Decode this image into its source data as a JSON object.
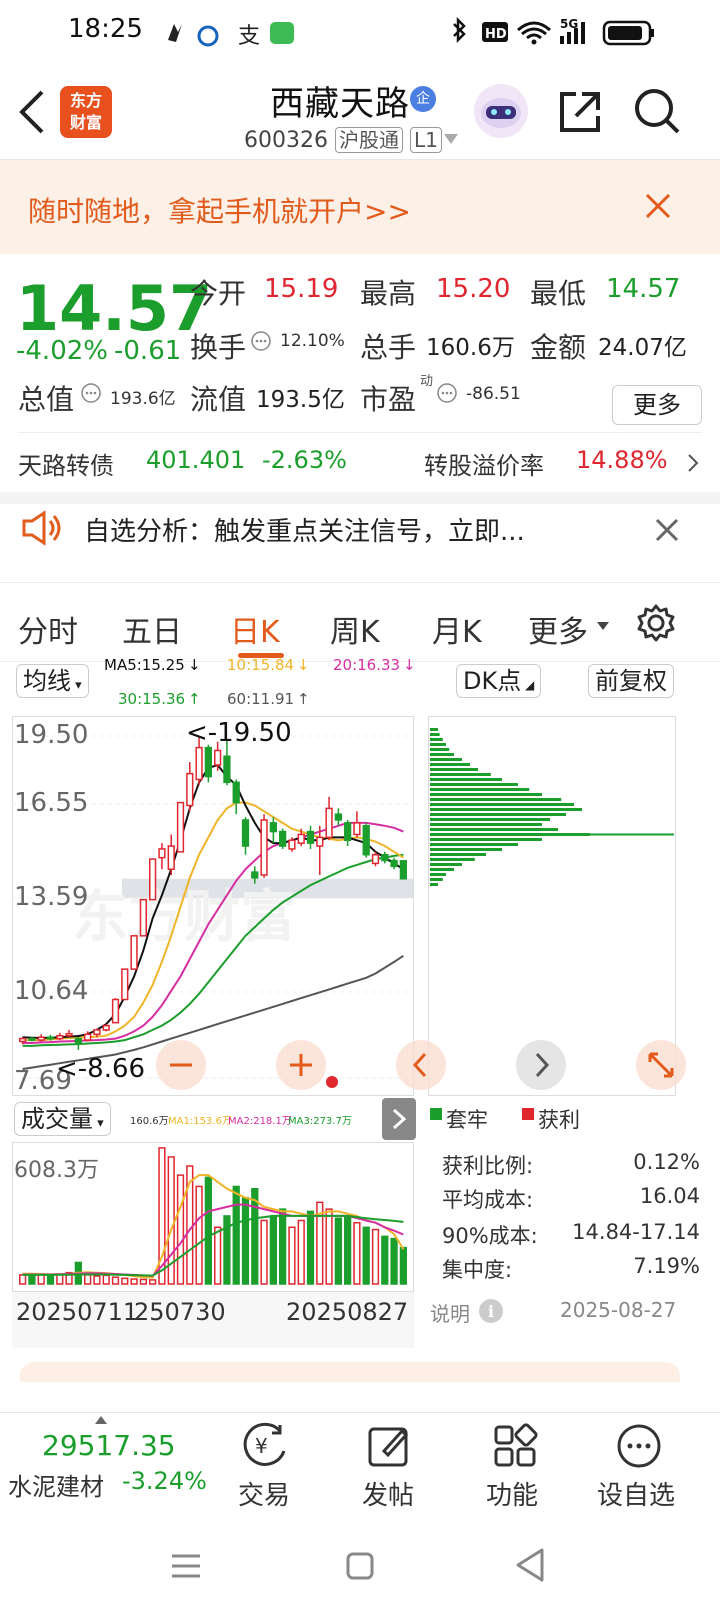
{
  "status": {
    "time": "18:25",
    "network": "5G"
  },
  "header": {
    "title": "西藏天路",
    "badge": "企",
    "code": "600326",
    "tag1": "沪股通",
    "tag2": "L1",
    "logo_line1": "东方",
    "logo_line2": "财富"
  },
  "promo": {
    "text": "随时随地，拿起手机就开户>>"
  },
  "quote": {
    "price": "14.57",
    "change_pct": "-4.02%",
    "change": "-0.61",
    "open_label": "今开",
    "open": "15.19",
    "high_label": "最高",
    "high": "15.20",
    "low_label": "最低",
    "low": "14.57",
    "turnover_label": "换手",
    "turnover": "12.10%",
    "volume_label": "总手",
    "volume": "160.6万",
    "amount_label": "金额",
    "amount": "24.07亿",
    "mktcap_label": "总值",
    "mktcap": "193.6亿",
    "float_label": "流值",
    "float": "193.5亿",
    "pe_label": "市盈",
    "pe_sup": "动",
    "pe": "-86.51",
    "more": "更多"
  },
  "bond": {
    "name": "天路转债",
    "price": "401.401",
    "change": "-2.63%",
    "premium_label": "转股溢价率",
    "premium": "14.88%"
  },
  "alert": {
    "text": "自选分析：触发重点关注信号，立即..."
  },
  "tabs": [
    "分时",
    "五日",
    "日K",
    "周K",
    "月K",
    "更多"
  ],
  "active_tab": "日K",
  "chart": {
    "ma_select": "均线",
    "ma5": "MA5:15.25",
    "ma10": "10:15.84",
    "ma20": "20:16.33",
    "ma30": "30:15.36",
    "ma60": "60:11.91",
    "dk_select": "DK点",
    "adjust_select": "前复权",
    "y_labels": [
      "19.50",
      "16.55",
      "13.59",
      "10.64",
      "7.69"
    ],
    "high_mark": "19.50",
    "low_mark": "8.66",
    "vol_select": "成交量",
    "vol_legend": {
      "v": "160.6万",
      "ma1": "MA1:153.6万",
      "ma2": "MA2:218.1万",
      "ma3": "MA3:273.7万"
    },
    "vol_max": "608.3万",
    "x_labels": [
      "20250711",
      "250730",
      "20250827"
    ],
    "colors": {
      "up": "#e0262f",
      "down": "#1b9e2c",
      "ma5": "#111111",
      "ma10": "#f0b429",
      "ma20": "#d62ea2",
      "ma30": "#1b9e2c",
      "ma60": "#555555"
    }
  },
  "chips": {
    "legend_trap": "套牢",
    "legend_profit": "获利",
    "profit_ratio_label": "获利比例:",
    "profit_ratio": "0.12%",
    "avg_cost_label": "平均成本:",
    "avg_cost": "16.04",
    "cost90_label": "90%成本:",
    "cost90": "14.84-17.14",
    "concentration_label": "集中度:",
    "concentration": "7.19%",
    "note_label": "说明",
    "date": "2025-08-27"
  },
  "bottom": {
    "index_value": "29517.35",
    "index_name": "水泥建材",
    "index_change": "-3.24%",
    "nav": [
      "交易",
      "发帖",
      "功能",
      "设自选"
    ]
  },
  "chart_data": {
    "type": "candlestick",
    "title": "",
    "ylim": [
      7.69,
      19.5
    ],
    "candles": [
      {
        "o": 8.95,
        "c": 9.05,
        "h": 9.1,
        "l": 8.85
      },
      {
        "o": 9.05,
        "c": 9.0,
        "h": 9.12,
        "l": 8.95
      },
      {
        "o": 9.0,
        "c": 9.1,
        "h": 9.2,
        "l": 8.95
      },
      {
        "o": 9.1,
        "c": 9.05,
        "h": 9.18,
        "l": 8.98
      },
      {
        "o": 9.05,
        "c": 9.15,
        "h": 9.25,
        "l": 9.0
      },
      {
        "o": 9.15,
        "c": 9.22,
        "h": 9.35,
        "l": 9.1
      },
      {
        "o": 9.05,
        "c": 8.9,
        "h": 9.1,
        "l": 8.66
      },
      {
        "o": 9.0,
        "c": 9.2,
        "h": 9.3,
        "l": 8.95
      },
      {
        "o": 9.2,
        "c": 9.35,
        "h": 9.4,
        "l": 9.1
      },
      {
        "o": 9.35,
        "c": 9.5,
        "h": 9.55,
        "l": 9.3
      },
      {
        "o": 9.6,
        "c": 10.4,
        "h": 10.45,
        "l": 9.6
      },
      {
        "o": 10.4,
        "c": 11.45,
        "h": 11.45,
        "l": 10.4
      },
      {
        "o": 11.45,
        "c": 12.6,
        "h": 12.6,
        "l": 11.45
      },
      {
        "o": 12.6,
        "c": 13.85,
        "h": 13.85,
        "l": 12.6
      },
      {
        "o": 13.85,
        "c": 15.25,
        "h": 15.25,
        "l": 13.85
      },
      {
        "o": 15.3,
        "c": 15.6,
        "h": 15.8,
        "l": 14.9
      },
      {
        "o": 14.9,
        "c": 15.7,
        "h": 16.1,
        "l": 14.7
      },
      {
        "o": 15.5,
        "c": 17.2,
        "h": 17.2,
        "l": 15.5
      },
      {
        "o": 17.1,
        "c": 18.2,
        "h": 18.6,
        "l": 16.9
      },
      {
        "o": 18.0,
        "c": 19.1,
        "h": 19.5,
        "l": 17.8
      },
      {
        "o": 19.1,
        "c": 18.1,
        "h": 19.2,
        "l": 17.9
      },
      {
        "o": 18.5,
        "c": 19.0,
        "h": 19.3,
        "l": 18.3
      },
      {
        "o": 18.8,
        "c": 17.9,
        "h": 19.4,
        "l": 17.8
      },
      {
        "o": 17.9,
        "c": 17.2,
        "h": 18.0,
        "l": 16.8
      },
      {
        "o": 16.6,
        "c": 15.7,
        "h": 16.7,
        "l": 15.4
      },
      {
        "o": 14.8,
        "c": 14.6,
        "h": 15.0,
        "l": 14.4
      },
      {
        "o": 14.7,
        "c": 16.6,
        "h": 16.8,
        "l": 14.6
      },
      {
        "o": 16.5,
        "c": 16.2,
        "h": 16.7,
        "l": 15.8
      },
      {
        "o": 16.2,
        "c": 15.7,
        "h": 16.3,
        "l": 15.6
      },
      {
        "o": 15.6,
        "c": 15.9,
        "h": 16.0,
        "l": 15.5
      },
      {
        "o": 15.8,
        "c": 16.1,
        "h": 16.3,
        "l": 15.7
      },
      {
        "o": 16.2,
        "c": 15.8,
        "h": 16.4,
        "l": 15.6
      },
      {
        "o": 15.7,
        "c": 16.0,
        "h": 16.4,
        "l": 14.7
      },
      {
        "o": 16.0,
        "c": 17.0,
        "h": 17.4,
        "l": 15.9
      },
      {
        "o": 16.8,
        "c": 16.6,
        "h": 17.0,
        "l": 16.4
      },
      {
        "o": 16.5,
        "c": 15.9,
        "h": 16.6,
        "l": 15.7
      },
      {
        "o": 16.1,
        "c": 16.5,
        "h": 16.9,
        "l": 16.0
      },
      {
        "o": 16.4,
        "c": 15.4,
        "h": 16.5,
        "l": 15.3
      },
      {
        "o": 15.1,
        "c": 15.4,
        "h": 15.5,
        "l": 15.0
      },
      {
        "o": 15.4,
        "c": 15.2,
        "h": 15.5,
        "l": 15.1
      },
      {
        "o": 15.2,
        "c": 15.0,
        "h": 15.3,
        "l": 14.9
      },
      {
        "o": 15.19,
        "c": 14.57,
        "h": 15.2,
        "l": 14.57
      }
    ],
    "ma5": [
      9.1,
      9.08,
      9.07,
      9.08,
      9.1,
      9.12,
      9.14,
      9.2,
      9.35,
      9.55,
      9.9,
      10.5,
      11.2,
      12.1,
      13.2,
      14.0,
      14.9,
      15.9,
      17.0,
      17.9,
      18.4,
      18.5,
      18.1,
      17.8,
      17.1,
      16.5,
      16.0,
      15.8,
      15.8,
      15.9,
      16.0,
      15.9,
      15.9,
      16.0,
      16.0,
      16.0,
      15.9,
      15.8,
      15.5,
      15.3,
      15.1,
      14.9
    ],
    "ma10": [
      9.0,
      9.0,
      9.0,
      9.02,
      9.05,
      9.07,
      9.08,
      9.1,
      9.12,
      9.15,
      9.3,
      9.5,
      9.8,
      10.3,
      10.9,
      11.7,
      12.6,
      13.6,
      14.6,
      15.4,
      16.0,
      16.6,
      17.0,
      17.2,
      17.2,
      17.1,
      16.9,
      16.7,
      16.5,
      16.3,
      16.2,
      16.1,
      16.0,
      15.95,
      15.9,
      15.95,
      16.0,
      15.95,
      15.85,
      15.7,
      15.5,
      15.3
    ],
    "ma20": [
      8.9,
      8.9,
      8.92,
      8.93,
      8.95,
      8.96,
      8.97,
      8.99,
      9.0,
      9.02,
      9.05,
      9.15,
      9.3,
      9.5,
      9.8,
      10.2,
      10.7,
      11.2,
      11.8,
      12.4,
      13.0,
      13.5,
      14.0,
      14.5,
      14.9,
      15.2,
      15.5,
      15.7,
      15.8,
      15.9,
      16.0,
      16.1,
      16.2,
      16.3,
      16.4,
      16.5,
      16.5,
      16.5,
      16.45,
      16.4,
      16.33,
      16.2
    ],
    "ma30": [
      8.8,
      8.8,
      8.82,
      8.83,
      8.84,
      8.85,
      8.86,
      8.88,
      8.9,
      8.92,
      8.95,
      9.0,
      9.1,
      9.2,
      9.35,
      9.5,
      9.7,
      9.95,
      10.25,
      10.6,
      11.0,
      11.4,
      11.8,
      12.2,
      12.6,
      12.9,
      13.2,
      13.5,
      13.75,
      13.95,
      14.15,
      14.35,
      14.5,
      14.65,
      14.8,
      14.95,
      15.05,
      15.15,
      15.25,
      15.3,
      15.36,
      15.4
    ],
    "ma60": [
      8.0,
      8.05,
      8.1,
      8.15,
      8.2,
      8.25,
      8.3,
      8.35,
      8.4,
      8.45,
      8.5,
      8.58,
      8.66,
      8.75,
      8.85,
      8.95,
      9.05,
      9.15,
      9.25,
      9.35,
      9.45,
      9.55,
      9.65,
      9.75,
      9.85,
      9.95,
      10.05,
      10.15,
      10.25,
      10.35,
      10.45,
      10.55,
      10.65,
      10.75,
      10.85,
      10.95,
      11.05,
      11.15,
      11.3,
      11.5,
      11.7,
      11.91
    ],
    "volume": [
      40,
      35,
      45,
      38,
      42,
      50,
      95,
      40,
      35,
      38,
      30,
      25,
      22,
      20,
      18,
      600,
      560,
      480,
      520,
      430,
      470,
      250,
      300,
      430,
      380,
      420,
      280,
      300,
      330,
      250,
      280,
      320,
      360,
      330,
      290,
      300,
      270,
      250,
      240,
      210,
      200,
      160.6
    ],
    "vol_ma1": [
      45,
      45,
      44,
      43,
      43,
      44,
      50,
      52,
      50,
      48,
      44,
      40,
      35,
      30,
      28,
      120,
      240,
      340,
      450,
      480,
      480,
      450,
      420,
      400,
      380,
      370,
      340,
      330,
      320,
      320,
      310,
      300,
      310,
      320,
      320,
      310,
      300,
      280,
      270,
      250,
      220,
      153.6
    ],
    "vol_ma2": [
      42,
      42,
      42,
      42,
      43,
      44,
      46,
      47,
      47,
      46,
      44,
      42,
      40,
      38,
      36,
      80,
      130,
      180,
      240,
      290,
      320,
      330,
      340,
      350,
      350,
      340,
      330,
      320,
      310,
      300,
      300,
      300,
      300,
      300,
      300,
      300,
      290,
      280,
      270,
      250,
      235,
      218.1
    ],
    "vol_ma3": [
      40,
      40,
      40,
      40,
      41,
      41,
      42,
      42,
      42,
      42,
      41,
      40,
      39,
      38,
      37,
      60,
      90,
      120,
      150,
      180,
      210,
      230,
      250,
      270,
      280,
      290,
      295,
      300,
      300,
      300,
      300,
      300,
      300,
      300,
      300,
      300,
      295,
      290,
      285,
      282,
      278,
      273.7
    ],
    "chips_profile": [
      0.05,
      0.06,
      0.08,
      0.1,
      0.12,
      0.15,
      0.2,
      0.25,
      0.3,
      0.38,
      0.45,
      0.55,
      0.62,
      0.7,
      0.82,
      0.9,
      0.95,
      0.85,
      0.75,
      0.7,
      0.8,
      1.0,
      0.7,
      0.55,
      0.45,
      0.35,
      0.28,
      0.2,
      0.15,
      0.1,
      0.08,
      0.05
    ]
  }
}
